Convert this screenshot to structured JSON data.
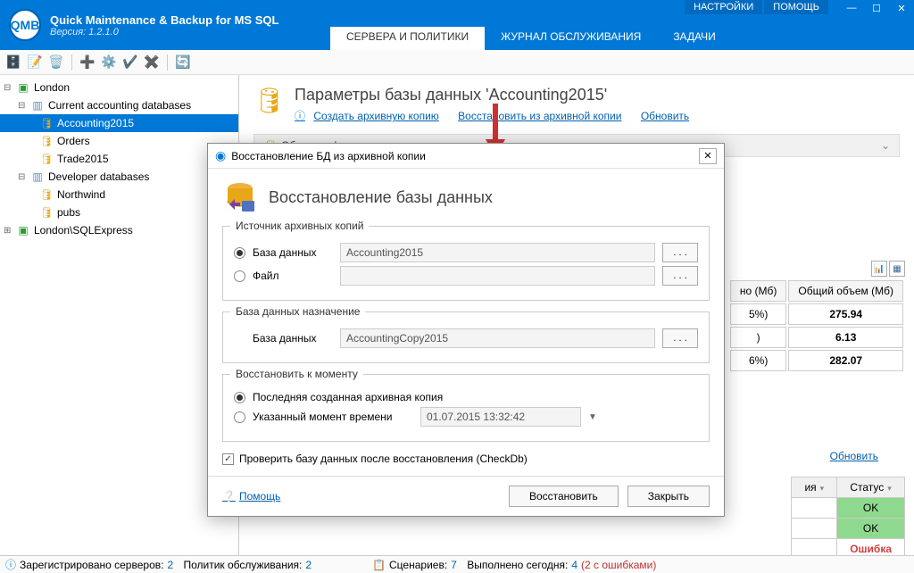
{
  "app": {
    "title": "Quick Maintenance & Backup for MS SQL",
    "version": "Версия: 1.2.1.0"
  },
  "top_links": {
    "settings": "НАСТРОЙКИ",
    "help": "ПОМОЩЬ"
  },
  "tabs": {
    "t0": "СЕРВЕРА И ПОЛИТИКИ",
    "t1": "ЖУРНАЛ ОБСЛУЖИВАНИЯ",
    "t2": "ЗАДАЧИ"
  },
  "tree": {
    "n0": "London",
    "n1": "Current accounting databases",
    "n2": "Accounting2015",
    "n3": "Orders",
    "n4": "Trade2015",
    "n5": "Developer databases",
    "n6": "Northwind",
    "n7": "pubs",
    "n8": "London\\SQLExpress"
  },
  "page": {
    "title": "Параметры базы данных 'Accounting2015'",
    "link_backup": "Создать архивную копию",
    "link_restore": "Восстановить из архивной копии",
    "link_refresh": "Обновить",
    "section": "Общая информация"
  },
  "table": {
    "col1": "но (Мб)",
    "col2": "Общий объем (Мб)",
    "r1a": "5%)",
    "r1b": "275.94",
    "r2a": ")",
    "r2b": "6.13",
    "r3a": "6%)",
    "r3b": "282.07"
  },
  "refresh2": "Обновить",
  "status_col_a": "ия",
  "status_col_b": "Статус",
  "status": {
    "ok": "OK",
    "err": "Ошибка"
  },
  "statusbar": {
    "s1a": "Зарегистрировано серверов:",
    "s1b": "2",
    "s2a": "Политик обслуживания:",
    "s2b": "2",
    "s3a": "Сценариев:",
    "s3b": "7",
    "s4a": "Выполнено сегодня:",
    "s4b": "4",
    "s4c": "(2 с ошибками)"
  },
  "modal": {
    "wintitle": "Восстановление БД из архивной копии",
    "title": "Восстановление базы данных",
    "fs1": "Источник архивных копий",
    "opt_db": "База данных",
    "opt_file": "Файл",
    "src_db_value": "Accounting2015",
    "fs2": "База данных назначение",
    "dest_label": "База данных",
    "dest_value": "AccountingCopy2015",
    "fs3": "Восстановить к моменту",
    "opt_last": "Последняя созданная архивная копия",
    "opt_time": "Указанный момент времени",
    "time_value": "01.07.2015 13:32:42",
    "check": "Проверить базу данных после восстановления (CheckDb)",
    "help": "Помощь",
    "btn_restore": "Восстановить",
    "btn_close": "Закрыть",
    "browse": ". . ."
  }
}
